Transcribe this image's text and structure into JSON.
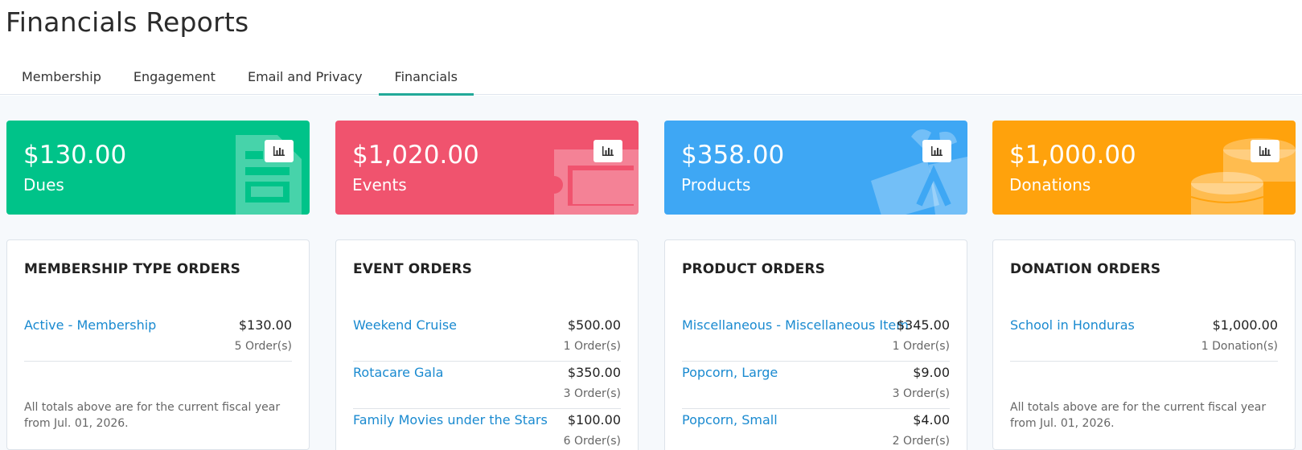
{
  "page": {
    "title": "Financials Reports"
  },
  "tabs": [
    {
      "label": "Membership"
    },
    {
      "label": "Engagement"
    },
    {
      "label": "Email and Privacy"
    },
    {
      "label": "Financials"
    }
  ],
  "active_tab": "Financials",
  "colors": {
    "dues": "#00c389",
    "events": "#f0536e",
    "products": "#3ea7f4",
    "donations": "#ffa20c",
    "tab_accent": "#22a999",
    "link": "#1a8ad0"
  },
  "stats": [
    {
      "amount": "$130.00",
      "label": "Dues",
      "icon": "document-icon"
    },
    {
      "amount": "$1,020.00",
      "label": "Events",
      "icon": "ticket-icon"
    },
    {
      "amount": "$358.00",
      "label": "Products",
      "icon": "gift-box-icon"
    },
    {
      "amount": "$1,000.00",
      "label": "Donations",
      "icon": "coins-icon"
    }
  ],
  "cards": [
    {
      "title": "MEMBERSHIP TYPE ORDERS",
      "rows": [
        {
          "name": "Active - Membership",
          "amount": "$130.00",
          "count": "5 Order(s)"
        }
      ],
      "note": "All totals above are for the current fiscal year from Jul. 01, 2026."
    },
    {
      "title": "EVENT ORDERS",
      "rows": [
        {
          "name": "Weekend Cruise",
          "amount": "$500.00",
          "count": "1 Order(s)"
        },
        {
          "name": "Rotacare Gala",
          "amount": "$350.00",
          "count": "3 Order(s)"
        },
        {
          "name": "Family Movies under the Stars",
          "amount": "$100.00",
          "count": "6 Order(s)"
        }
      ]
    },
    {
      "title": "PRODUCT ORDERS",
      "rows": [
        {
          "name": "Miscellaneous - Miscellaneous Item",
          "amount": "$345.00",
          "count": "1 Order(s)"
        },
        {
          "name": "Popcorn, Large",
          "amount": "$9.00",
          "count": "3 Order(s)"
        },
        {
          "name": "Popcorn, Small",
          "amount": "$4.00",
          "count": "2 Order(s)"
        }
      ]
    },
    {
      "title": "DONATION ORDERS",
      "rows": [
        {
          "name": "School in Honduras",
          "amount": "$1,000.00",
          "count": "1 Donation(s)"
        }
      ],
      "note": "All totals above are for the current fiscal year from Jul. 01, 2026."
    }
  ]
}
